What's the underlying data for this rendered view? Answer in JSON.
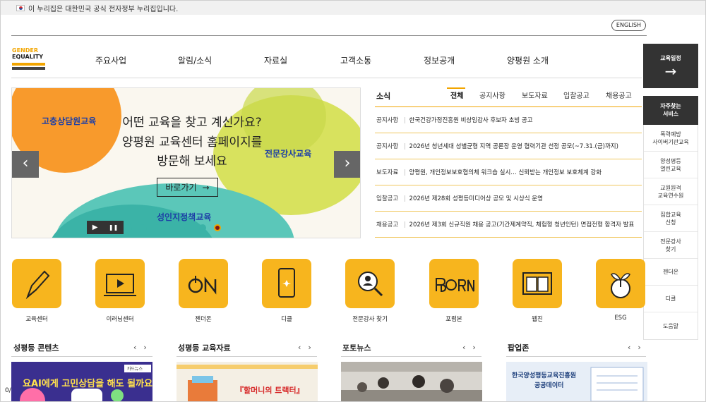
{
  "gov_bar": {
    "text": "이 누리집은 대한민국 공식 전자정부 누리집입니다."
  },
  "header": {
    "english_label": "ENGLISH",
    "logo": {
      "line1": "GENDER",
      "line2": "EQUALITY"
    },
    "menu": [
      "주요사업",
      "알림/소식",
      "자료실",
      "고객소통",
      "정보공개",
      "양평원 소개"
    ]
  },
  "quick": {
    "edu_schedule_label": "교육일정",
    "arrow": "→",
    "faq_label_1": "자주찾는",
    "faq_label_2": "서비스",
    "items": [
      {
        "line1": "폭력예방",
        "line2": "사이버기관교육"
      },
      {
        "line1": "양성평등",
        "line2": "열린교육"
      },
      {
        "line1": "교원원격",
        "line2": "교육연수원"
      },
      {
        "line1": "집합교육",
        "line2": "신청"
      },
      {
        "line1": "전문강사",
        "line2": "찾기"
      },
      {
        "line1": "젠더온",
        "line2": ""
      },
      {
        "line1": "디클",
        "line2": ""
      },
      {
        "line1": "도움말",
        "line2": ""
      }
    ]
  },
  "banner": {
    "label_counsel": "고충상담원교육",
    "label_expert": "전문강사교육",
    "label_adult": "성인지정책교육",
    "headline_1": "어떤 교육을 찾고 계신가요?",
    "headline_2": "양평원 교육센터 홈페이지를",
    "headline_3": "방문해 보세요",
    "go_label": "바로가기",
    "go_arrow": "→",
    "prev": "‹",
    "next": "›",
    "play": "▶",
    "pause": "❚❚",
    "dot_count": 7,
    "active_dot": 6
  },
  "news": {
    "title": "소식",
    "tabs": [
      "전체",
      "공지사항",
      "보도자료",
      "입찰공고",
      "채용공고"
    ],
    "rows": [
      {
        "cat": "공지사항",
        "text": "한국건강가정진흥원 비상임감사 후보자 초빙 공고"
      },
      {
        "cat": "공지사항",
        "text": "2026년 청년세대 성별균형 지역 공론장 운영 협력기관 선정 공모(~7.31.(금)까지)"
      },
      {
        "cat": "보도자료",
        "text": "양평원, 개인정보보호협의체 워크숍 실시… 신뢰받는 개인정보 보호체계 강화"
      },
      {
        "cat": "입찰공고",
        "text": "2026년 제28회 성평등미디어상 공모 및 시상식 운영"
      },
      {
        "cat": "채용공고",
        "text": "2026년 제3회 신규직원 채용 공고(기간제계약직, 체험형 청년인턴) 면접전형 합격자 발표"
      }
    ]
  },
  "services": [
    {
      "label": "교육센터",
      "icon": "pencil-icon"
    },
    {
      "label": "이러닝센터",
      "icon": "play-icon"
    },
    {
      "label": "젠더온",
      "icon": "on-icon"
    },
    {
      "label": "디클",
      "icon": "phone-icon"
    },
    {
      "label": "전문강사 찾기",
      "icon": "search-person-icon"
    },
    {
      "label": "포럼본",
      "icon": "born-icon"
    },
    {
      "label": "웹진",
      "icon": "book-icon"
    },
    {
      "label": "ESG",
      "icon": "leaf-icon"
    }
  ],
  "bottom": {
    "sections": [
      "성평등 콘텐츠",
      "성평등 교육자료",
      "포토뉴스",
      "팝업존"
    ],
    "arrow_prev": "‹",
    "arrow_next": "›",
    "card_news_badge": "카드뉴스",
    "card_news_text": "요AI에게 고민상담을 해도 될까요",
    "edu_book_title": "『할머니의 트랙터』",
    "popup_line1": "한국양성평등교육진흥원",
    "popup_line2": "공공데이터",
    "corner_text": "0/"
  },
  "colors": {
    "accent": "#f7b51e",
    "dark": "#333333",
    "teal": "#3bb3a7"
  }
}
